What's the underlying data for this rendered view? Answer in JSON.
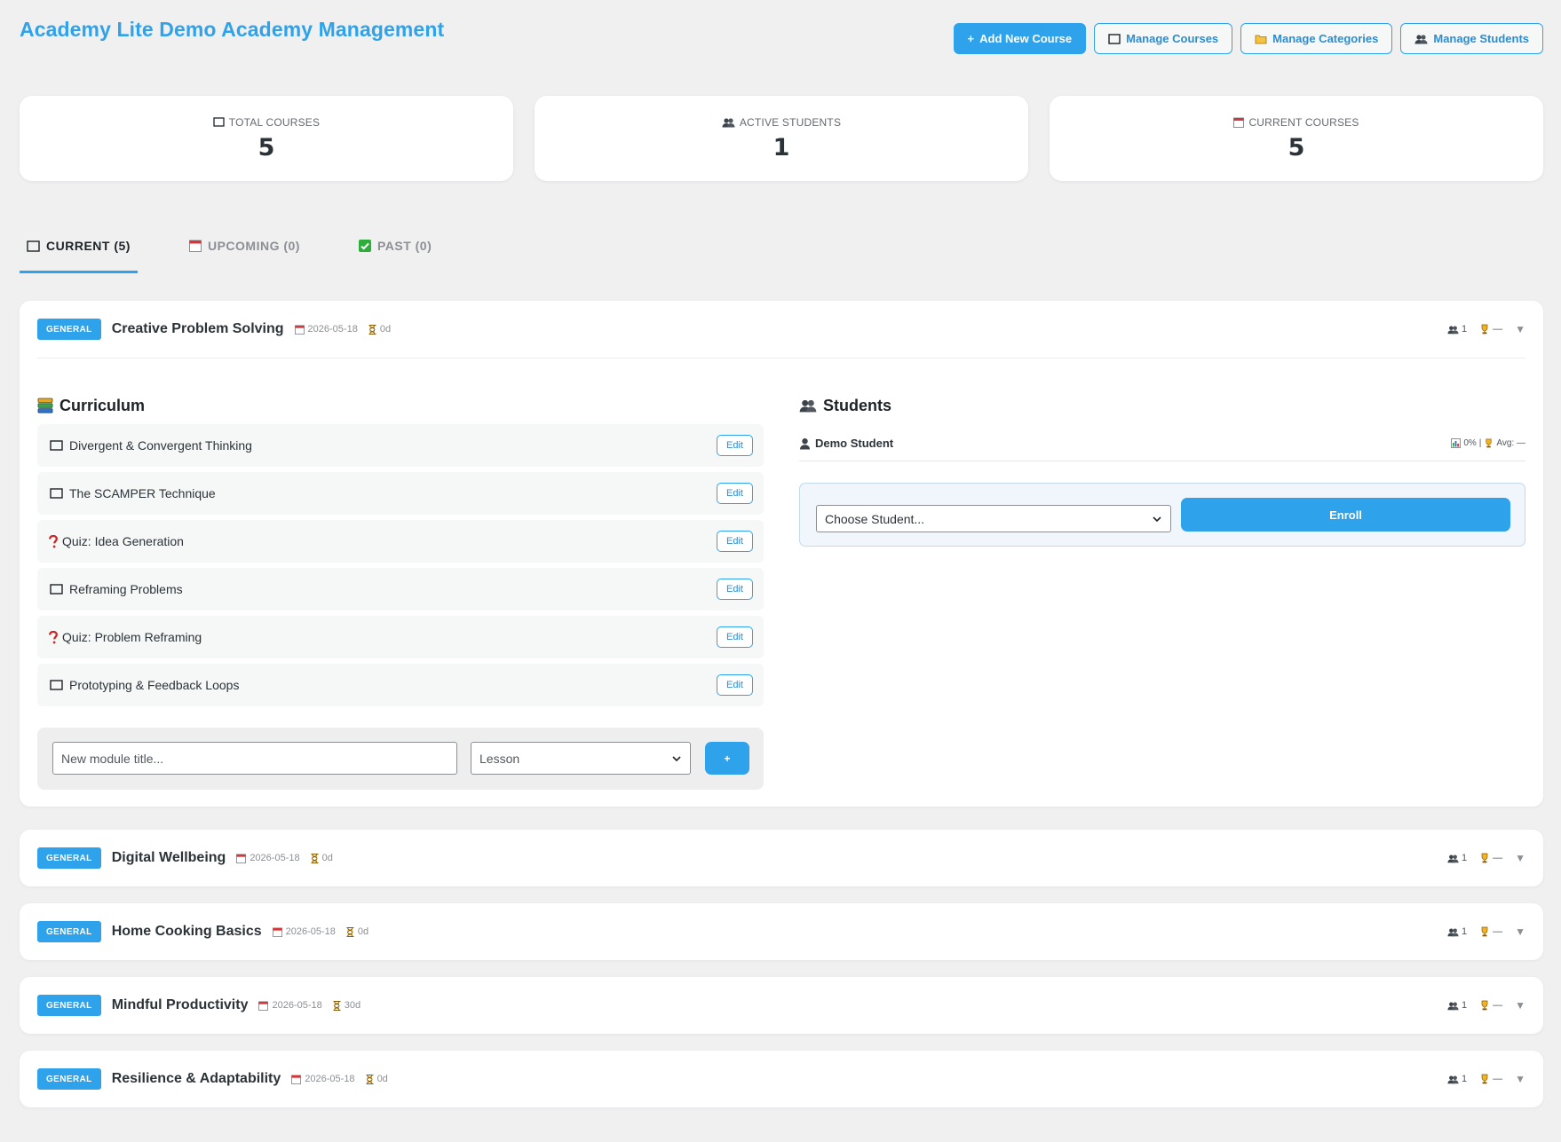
{
  "app_title": "Academy Lite Demo Academy Management",
  "actions": [
    {
      "label": "Add New Course",
      "icon": "+"
    },
    {
      "label": "Manage Courses",
      "icon": "book-icon"
    },
    {
      "label": "Manage Categories",
      "icon": "folder-icon"
    },
    {
      "label": "Manage Students",
      "icon": "students-icon"
    }
  ],
  "stats": [
    {
      "label": "Total Courses",
      "value": "5",
      "icon": "book-icon"
    },
    {
      "label": "Active Students",
      "value": "1",
      "icon": "students-icon"
    },
    {
      "label": "Current Courses",
      "value": "5",
      "icon": "calendar-icon"
    }
  ],
  "tabs": [
    {
      "label": "CURRENT (5)",
      "icon": "book-icon",
      "active": true
    },
    {
      "label": "UPCOMING (0)",
      "icon": "calendar-icon",
      "active": false
    },
    {
      "label": "PAST (0)",
      "icon": "check-icon",
      "active": false
    }
  ],
  "courses": [
    {
      "badge": "GENERAL",
      "title": "Creative Problem Solving",
      "date": "2026-05-18",
      "duration": "0d",
      "students": "1",
      "score": "—",
      "expanded": true
    },
    {
      "badge": "GENERAL",
      "title": "Digital Wellbeing",
      "date": "2026-05-18",
      "duration": "0d",
      "students": "1",
      "score": "—"
    },
    {
      "badge": "GENERAL",
      "title": "Home Cooking Basics",
      "date": "2026-05-18",
      "duration": "0d",
      "students": "1",
      "score": "—"
    },
    {
      "badge": "GENERAL",
      "title": "Mindful Productivity",
      "date": "2026-05-18",
      "duration": "30d",
      "students": "1",
      "score": "—"
    },
    {
      "badge": "GENERAL",
      "title": "Resilience & Adaptability",
      "date": "2026-05-18",
      "duration": "0d",
      "students": "1",
      "score": "—"
    }
  ],
  "curriculum": {
    "title": "Curriculum",
    "modules": [
      {
        "type": "lesson",
        "title": "Divergent & Convergent Thinking"
      },
      {
        "type": "lesson",
        "title": "The SCAMPER Technique"
      },
      {
        "type": "quiz",
        "title": "Quiz: Idea Generation"
      },
      {
        "type": "lesson",
        "title": "Reframing Problems"
      },
      {
        "type": "quiz",
        "title": "Quiz: Problem Reframing"
      },
      {
        "type": "lesson",
        "title": "Prototyping & Feedback Loops"
      }
    ],
    "edit_label": "Edit",
    "new_module_placeholder": "New module title...",
    "module_type": "Lesson",
    "add_label": "+"
  },
  "students": {
    "title": "Students",
    "list": [
      {
        "name": "Demo Student",
        "progress": "0%",
        "avg": "Avg: —"
      }
    ],
    "choose_placeholder": "Choose Student...",
    "enroll_label": "Enroll"
  },
  "colors": {
    "accent": "#2ea2ea",
    "background": "#f0f0f1"
  }
}
